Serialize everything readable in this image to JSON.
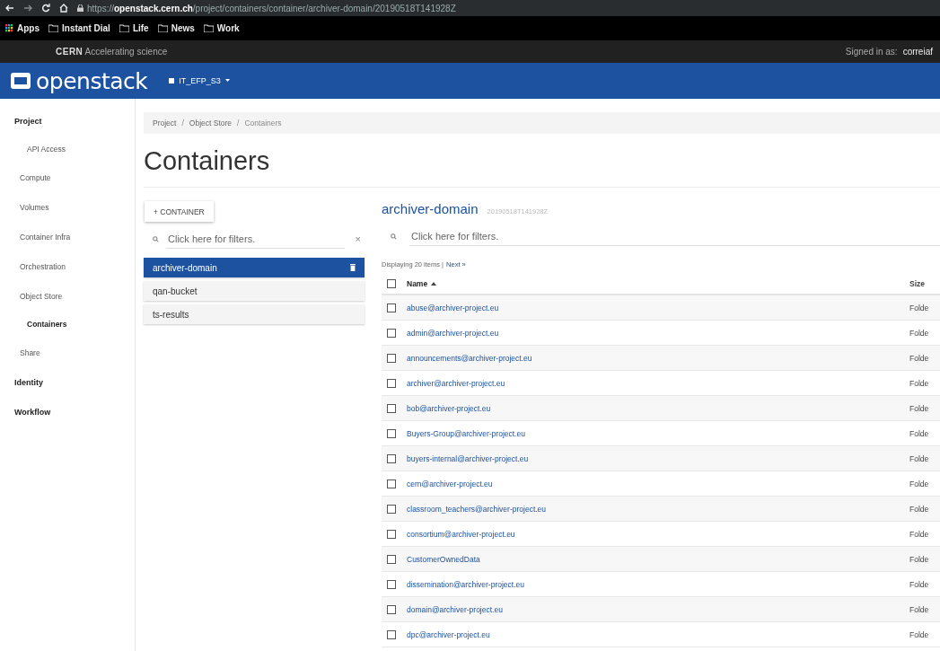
{
  "browser": {
    "url_scheme": "https://",
    "url_host": "openstack.cern.ch",
    "url_path": "/project/containers/container/archiver-domain/20190518T141928Z",
    "bookmarks": [
      {
        "kind": "apps",
        "label": "Apps"
      },
      {
        "kind": "folder",
        "label": "Instant Dial"
      },
      {
        "kind": "folder",
        "label": "Life"
      },
      {
        "kind": "folder",
        "label": "News"
      },
      {
        "kind": "folder",
        "label": "Work"
      }
    ]
  },
  "cern_bar": {
    "brand": "CERN",
    "tagline": "Accelerating science",
    "signed_in_label": "Signed in as:",
    "user": "correiaf"
  },
  "header": {
    "logo": "openstack",
    "project": "IT_EFP_S3"
  },
  "sidebar": {
    "items": [
      {
        "kind": "section",
        "label": "Project"
      },
      {
        "kind": "sub",
        "label": "API Access",
        "selected": false
      },
      {
        "kind": "item",
        "label": "Compute",
        "selected": false
      },
      {
        "kind": "item",
        "label": "Volumes",
        "selected": false
      },
      {
        "kind": "item",
        "label": "Container Infra",
        "selected": false
      },
      {
        "kind": "item",
        "label": "Orchestration",
        "selected": false
      },
      {
        "kind": "item",
        "label": "Object Store",
        "selected": false
      },
      {
        "kind": "sub",
        "label": "Containers",
        "selected": true
      },
      {
        "kind": "item",
        "label": "Share",
        "selected": false
      },
      {
        "kind": "section",
        "label": "Identity"
      },
      {
        "kind": "section",
        "label": "Workflow"
      }
    ]
  },
  "breadcrumb": {
    "separator": "/",
    "items": [
      "Project",
      "Object Store",
      "Containers"
    ]
  },
  "page_title": "Containers",
  "containers": {
    "add_button": "+ CONTAINER",
    "filter": {
      "placeholder": "Click here for filters.",
      "clear": "×"
    },
    "items": [
      {
        "name": "archiver-domain",
        "selected": true
      },
      {
        "name": "qan-bucket",
        "selected": false
      },
      {
        "name": "ts-results",
        "selected": false
      }
    ]
  },
  "objects": {
    "title": "archiver-domain",
    "timestamp": "20190518T141928Z",
    "filter": {
      "placeholder": "Click here for filters."
    },
    "summary": "Displaying 20 items |",
    "next_link": "Next »",
    "columns": [
      {
        "label": "Name",
        "sorted": true
      },
      {
        "label": "Size"
      }
    ],
    "select_all_checked": false,
    "rows": [
      {
        "name": "abuse@archiver-project.eu",
        "size": "Folde",
        "checked": false
      },
      {
        "name": "admin@archiver-project.eu",
        "size": "Folde",
        "checked": false
      },
      {
        "name": "announcements@archiver-project.eu",
        "size": "Folde",
        "checked": false
      },
      {
        "name": "archiver@archiver-project.eu",
        "size": "Folde",
        "checked": false
      },
      {
        "name": "bob@archiver-project.eu",
        "size": "Folde",
        "checked": false
      },
      {
        "name": "Buyers-Group@archiver-project.eu",
        "size": "Folde",
        "checked": false
      },
      {
        "name": "buyers-internal@archiver-project.eu",
        "size": "Folde",
        "checked": false
      },
      {
        "name": "cern@archiver-project.eu",
        "size": "Folde",
        "checked": false
      },
      {
        "name": "classroom_teachers@archiver-project.eu",
        "size": "Folde",
        "checked": false
      },
      {
        "name": "consortium@archiver-project.eu",
        "size": "Folde",
        "checked": false
      },
      {
        "name": "CustomerOwnedData",
        "size": "Folde",
        "checked": false
      },
      {
        "name": "dissemination@archiver-project.eu",
        "size": "Folde",
        "checked": false
      },
      {
        "name": "domain@archiver-project.eu",
        "size": "Folde",
        "checked": false
      },
      {
        "name": "dpc@archiver-project.eu",
        "size": "Folde",
        "checked": false
      }
    ]
  }
}
